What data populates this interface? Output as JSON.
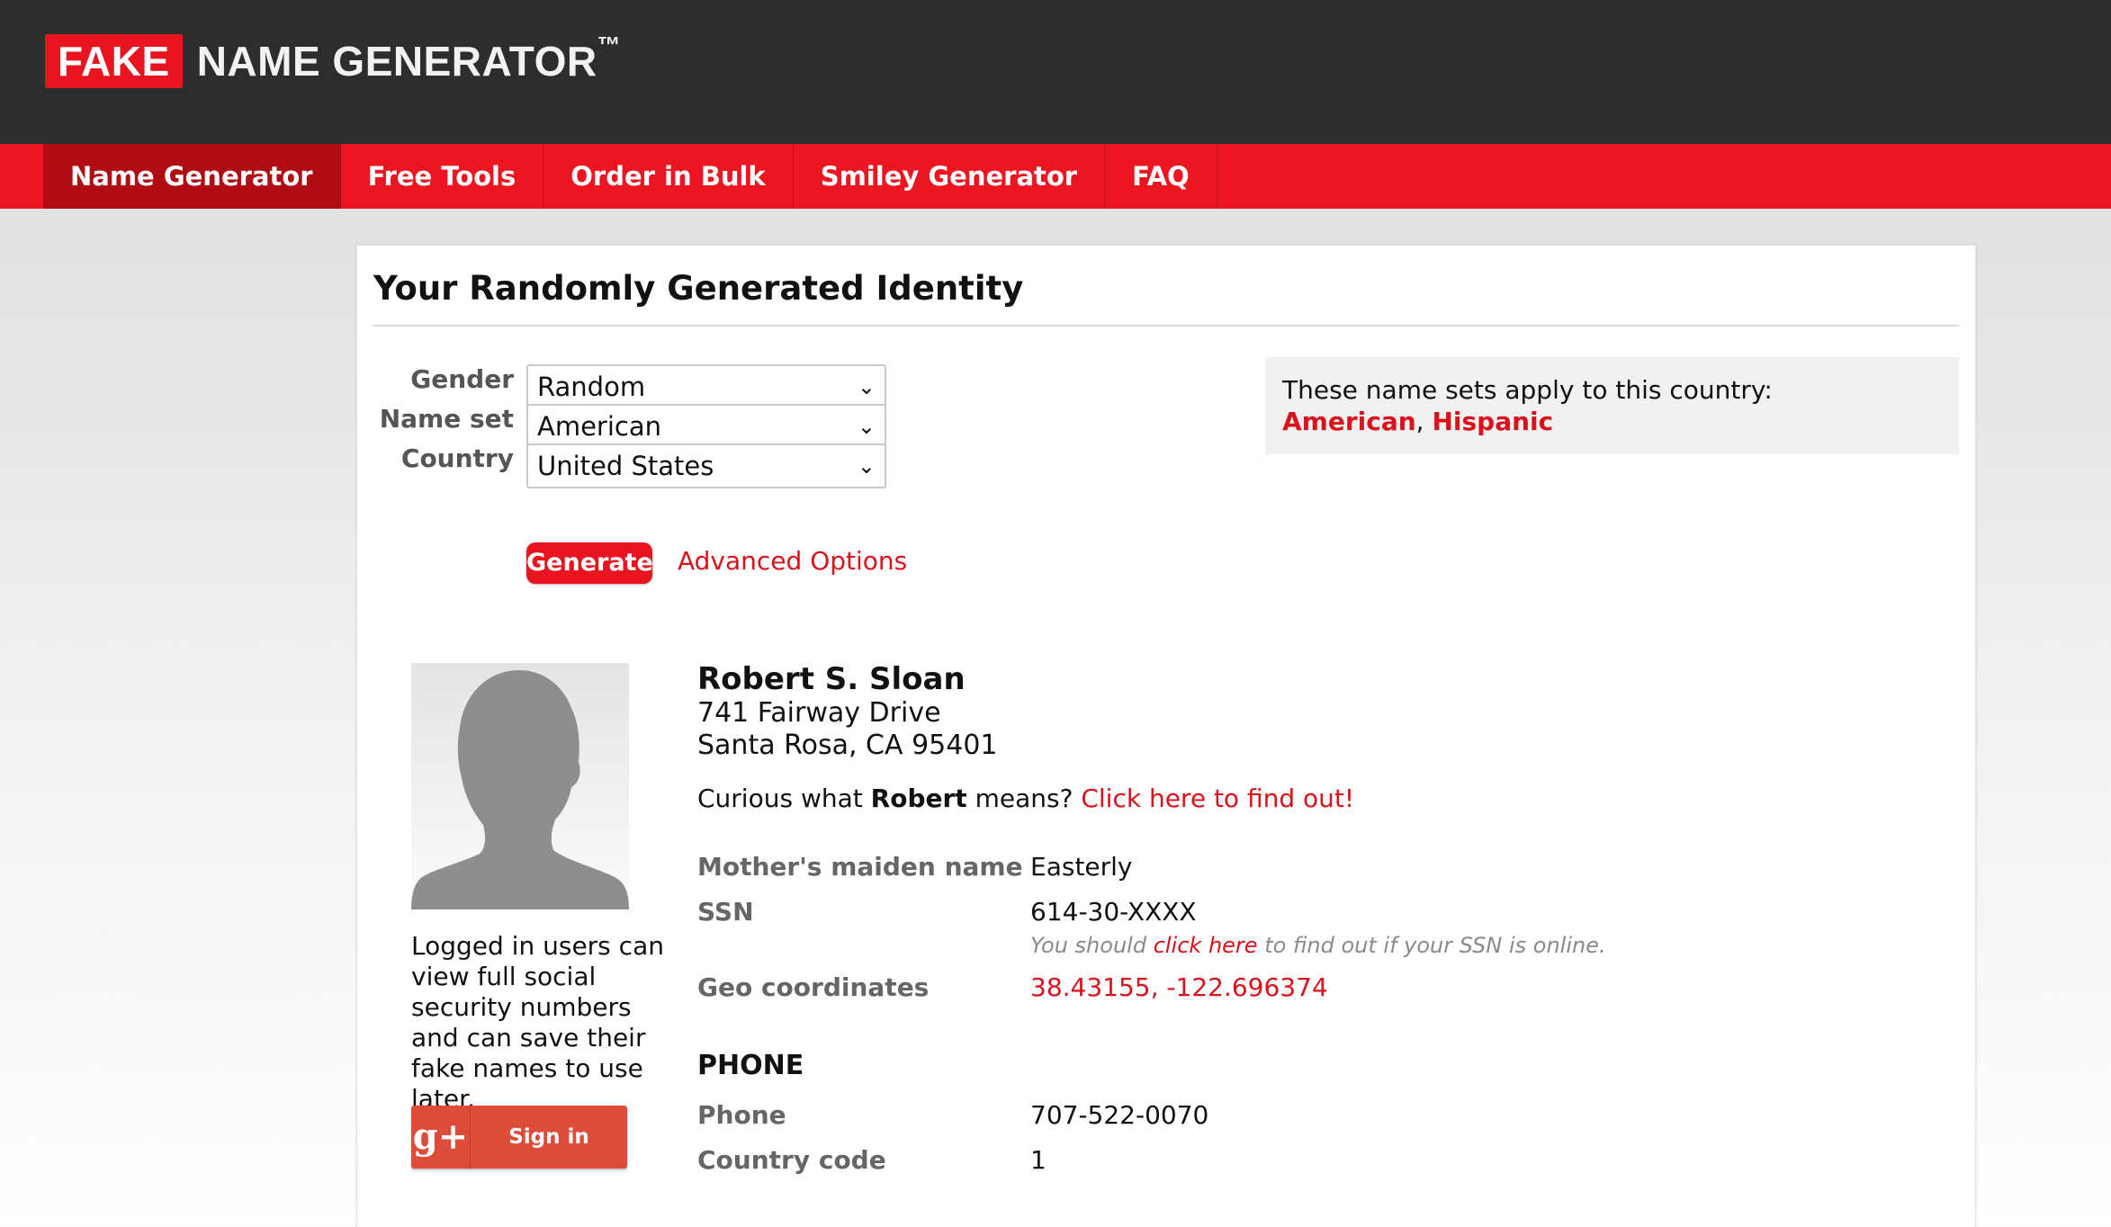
{
  "header": {
    "logo_fake": "FAKE",
    "logo_rest": "NAME GENERATOR",
    "logo_tm": "™"
  },
  "nav": {
    "items": [
      {
        "label": "Name Generator",
        "active": true
      },
      {
        "label": "Free Tools"
      },
      {
        "label": "Order in Bulk"
      },
      {
        "label": "Smiley Generator"
      },
      {
        "label": "FAQ"
      }
    ]
  },
  "page": {
    "title": "Your Randomly Generated Identity"
  },
  "form": {
    "gender": {
      "label": "Gender",
      "value": "Random"
    },
    "name_set": {
      "label": "Name set",
      "value": "American"
    },
    "country": {
      "label": "Country",
      "value": "United States"
    },
    "generate_label": "Generate",
    "advanced_label": "Advanced Options"
  },
  "info_box": {
    "text": "These name sets apply to this country:",
    "links": [
      "American",
      "Hispanic"
    ],
    "separator": ", "
  },
  "sidebar": {
    "login_note": "Logged in users can view full social security numbers and can save their fake names to use later.",
    "gplus_icon": "g+",
    "gplus_label": "Sign in"
  },
  "identity": {
    "name": "Robert S. Sloan",
    "street": "741 Fairway Drive",
    "city_line": "Santa Rosa, CA 95401",
    "curious_prefix": "Curious what ",
    "first_name": "Robert",
    "curious_suffix": " means? ",
    "curious_link": "Click here to find out!",
    "details": {
      "maiden_label": "Mother's maiden name",
      "maiden_value": "Easterly",
      "ssn_label": "SSN",
      "ssn_value": "614-30-XXXX",
      "ssn_note_prefix": "You should ",
      "ssn_note_link": "click here",
      "ssn_note_suffix": " to find out if your SSN is online.",
      "geo_label": "Geo coordinates",
      "geo_value": "38.43155, -122.696374"
    },
    "phone_section": {
      "heading": "PHONE",
      "phone_label": "Phone",
      "phone_value": "707-522-0070",
      "country_code_label": "Country code",
      "country_code_value": "1"
    }
  },
  "icons": {
    "select_chevron": "chevron-down-icon",
    "avatar": "person-silhouette-icon",
    "gplus": "google-plus-icon"
  },
  "colors": {
    "header_bg": "#2d2d2d",
    "brand_red": "#ec1622",
    "active_nav": "#b00c14",
    "link_red": "#d9121c",
    "gplus_red": "#dd4b39"
  }
}
